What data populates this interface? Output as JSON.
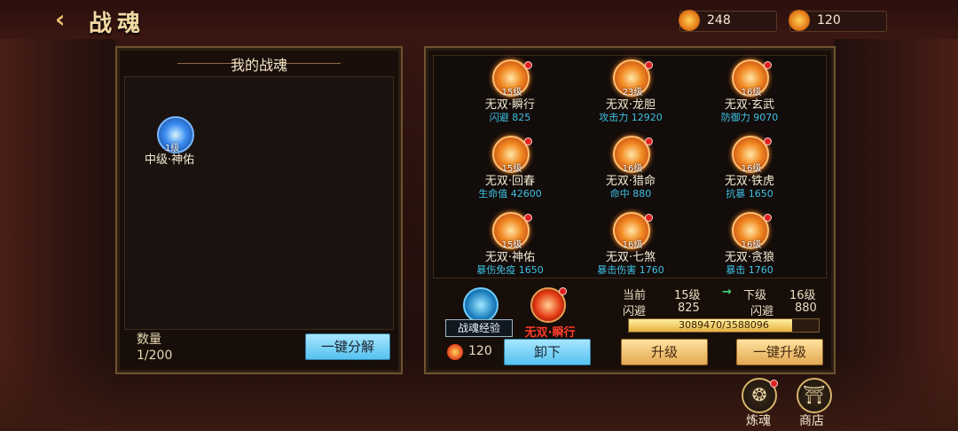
{
  "header": {
    "title": "战魂",
    "res1_value": "248",
    "res2_value": "120"
  },
  "left_panel": {
    "title": "我的战魂",
    "item": {
      "level": "1级",
      "name": "中级·神佑"
    },
    "quantity_label": "数量",
    "quantity_value": "1/200",
    "decompose_button": "一键分解"
  },
  "souls": [
    {
      "level": "15级",
      "name": "无双·瞬行",
      "stat": "闪避 825",
      "notify": true
    },
    {
      "level": "23级",
      "name": "无双·龙胆",
      "stat": "攻击力 12920",
      "notify": true
    },
    {
      "level": "16级",
      "name": "无双·玄武",
      "stat": "防御力 9070",
      "notify": true
    },
    {
      "level": "15级",
      "name": "无双·回春",
      "stat": "生命值 42600",
      "notify": true
    },
    {
      "level": "16级",
      "name": "无双·猎命",
      "stat": "命中 880",
      "notify": true
    },
    {
      "level": "16级",
      "name": "无双·铁虎",
      "stat": "抗暴 1650",
      "notify": true
    },
    {
      "level": "15级",
      "name": "无双·神佑",
      "stat": "暴伤免疫 1650",
      "notify": true
    },
    {
      "level": "16级",
      "name": "无双·七煞",
      "stat": "暴击伤害 1760",
      "notify": true
    },
    {
      "level": "16级",
      "name": "无双·贪狼",
      "stat": "暴击 1760",
      "notify": true
    }
  ],
  "bottom": {
    "exp_label": "战魂经验",
    "exp_count": "120",
    "selected_name": "无双·瞬行",
    "unequip_button": "卸下",
    "current_label": "当前",
    "current_level": "15级",
    "next_label": "下级",
    "next_level": "16级",
    "stat_name": "闪避",
    "current_stat": "825",
    "next_stat": "880",
    "progress_text": "3089470/3588096",
    "progress_fraction": 0.861,
    "upgrade_button": "升级",
    "upgrade_all_button": "一键升级",
    "arrow": "→"
  },
  "side": {
    "refine_label": "炼魂",
    "shop_label": "商店"
  }
}
